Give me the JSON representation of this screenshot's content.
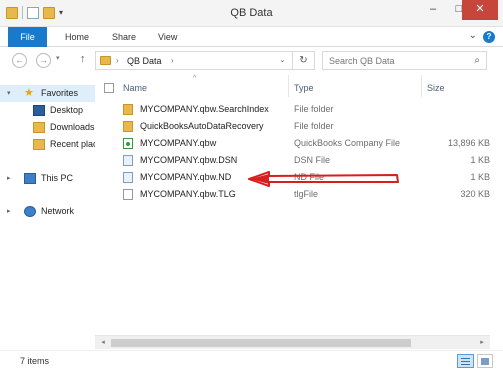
{
  "window": {
    "title": "QB Data",
    "minimize": "–",
    "maximize": "□",
    "close": "✕"
  },
  "ribbon": {
    "tabs": [
      "File",
      "Home",
      "Share",
      "View"
    ],
    "expand": "⌄",
    "help": "?"
  },
  "nav": {
    "back": "←",
    "forward": "→",
    "recent_dropdown": "▾",
    "up": "↑",
    "address_crumbs": [
      "QB Data"
    ],
    "crumb_sep": "›",
    "address_dropdown": "⌄",
    "refresh": "↻",
    "search_placeholder": "Search QB Data",
    "search_icon": "⌕"
  },
  "navpane": {
    "items": [
      {
        "label": "Favorites",
        "icon": "star-icon",
        "selected": true
      },
      {
        "label": "Desktop",
        "icon": "desktop-icon"
      },
      {
        "label": "Downloads",
        "icon": "downloads-icon"
      },
      {
        "label": "Recent places",
        "icon": "recent-places-icon"
      },
      {
        "label": "This PC",
        "icon": "computer-icon"
      },
      {
        "label": "Network",
        "icon": "network-icon"
      }
    ]
  },
  "filelist": {
    "columns": {
      "name": "Name",
      "type": "Type",
      "size": "Size"
    },
    "sort_indicator": "^",
    "rows": [
      {
        "name": "MYCOMPANY.qbw.SearchIndex",
        "type": "File folder",
        "size": "",
        "icon": "folder-icon"
      },
      {
        "name": "QuickBooksAutoDataRecovery",
        "type": "File folder",
        "size": "",
        "icon": "folder-icon"
      },
      {
        "name": "MYCOMPANY.qbw",
        "type": "QuickBooks Company File",
        "size": "13,896 KB",
        "icon": "quickbooks-file-icon"
      },
      {
        "name": "MYCOMPANY.qbw.DSN",
        "type": "DSN File",
        "size": "1 KB",
        "icon": "dsn-file-icon"
      },
      {
        "name": "MYCOMPANY.qbw.ND",
        "type": "ND File",
        "size": "1 KB",
        "icon": "nd-file-icon"
      },
      {
        "name": "MYCOMPANY.qbw.TLG",
        "type": "tlgFile",
        "size": "320 KB",
        "icon": "tlg-file-icon"
      }
    ]
  },
  "hscroll": {
    "left": "◂",
    "right": "▸"
  },
  "status": {
    "item_count": "7 items"
  },
  "colors": {
    "accent": "#1979ca",
    "close": "#c7463b",
    "annotation": "#d81e1e"
  }
}
